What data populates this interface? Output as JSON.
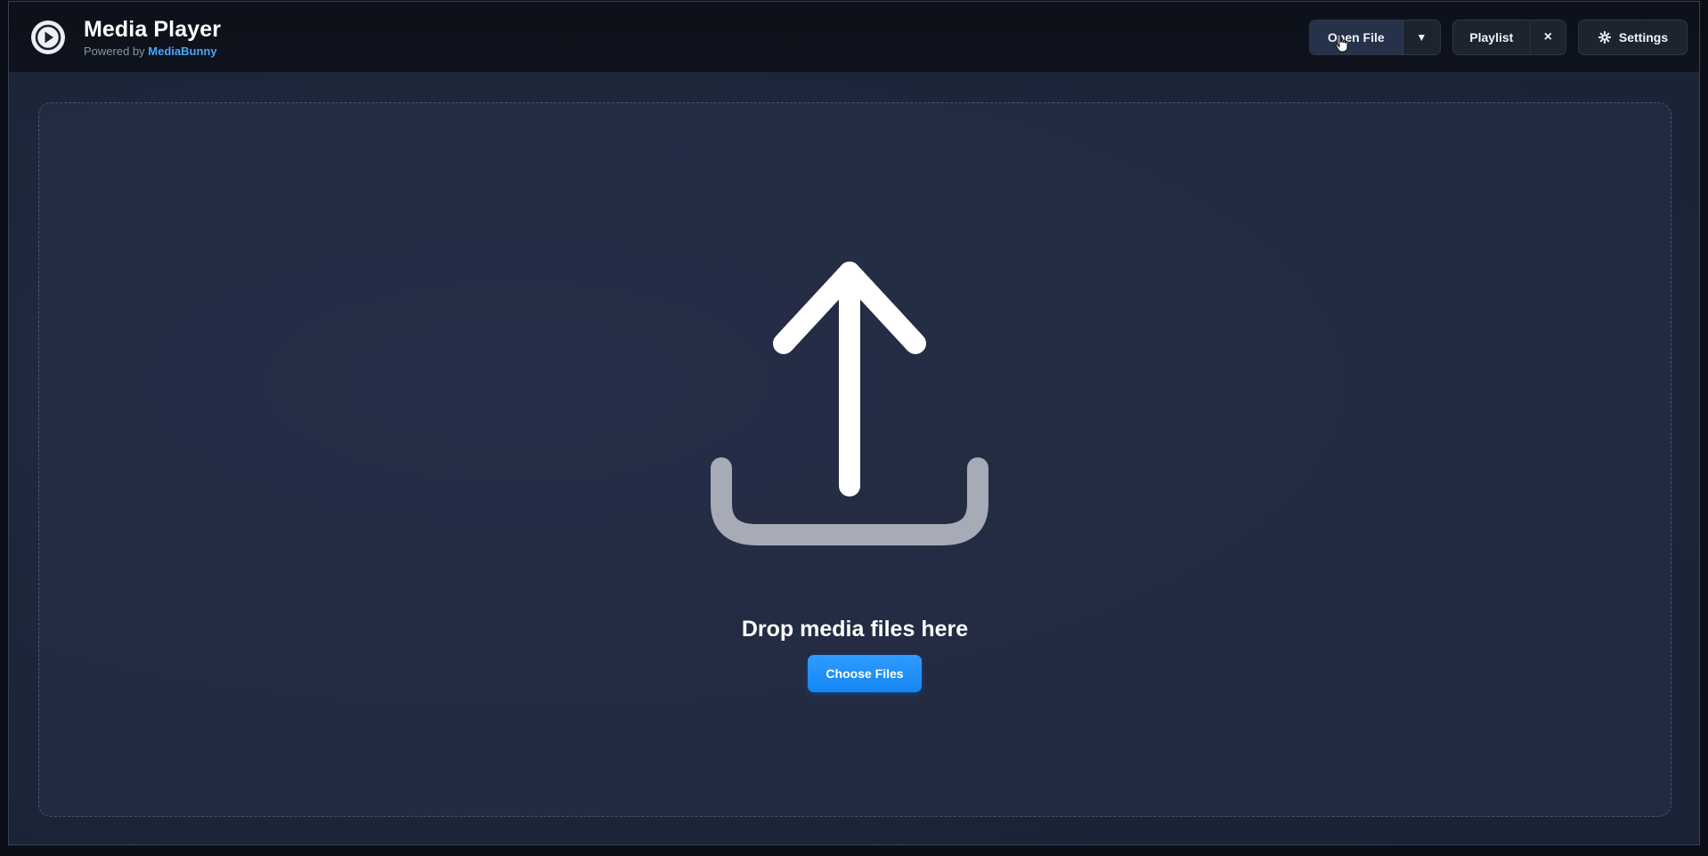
{
  "app": {
    "title": "Media Player",
    "powered_prefix": "Powered by",
    "powered_brand": "MediaBunny",
    "logo_icon": "play-circle-icon"
  },
  "toolbar": {
    "open_file_label": "Open File",
    "open_file_dropdown_glyph": "▼",
    "playlist_label": "Playlist",
    "playlist_close_glyph": "×",
    "settings_label": "Settings",
    "settings_icon": "gear-icon"
  },
  "dropzone": {
    "icon": "upload-icon",
    "title": "Drop media files here",
    "choose_label": "Choose Files"
  },
  "colors": {
    "accent": "#1e8ff8",
    "brand_accent": "#4aa4ff",
    "background": "#1c2438",
    "topbar": "#0c1019"
  }
}
